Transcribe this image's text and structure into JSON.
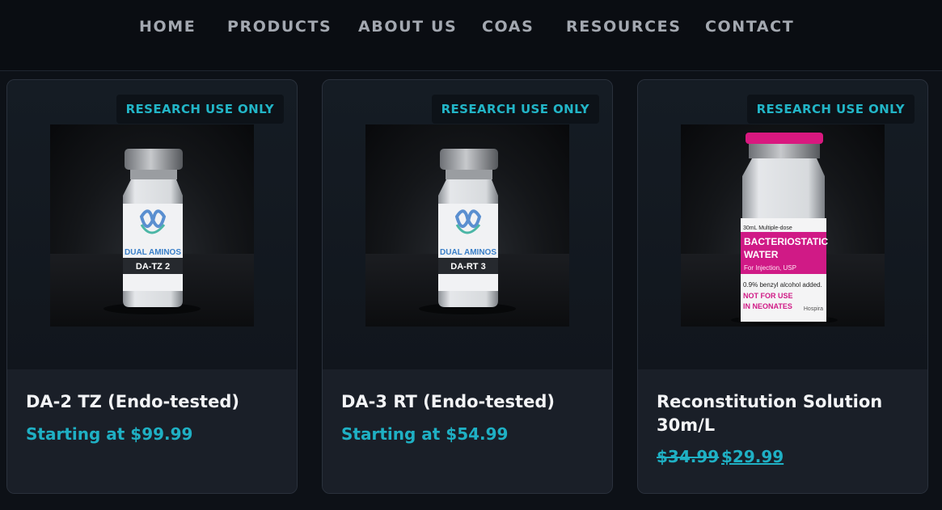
{
  "nav": {
    "items": [
      {
        "label": "HOME"
      },
      {
        "label": "PRODUCTS"
      },
      {
        "label": "ABOUT US"
      },
      {
        "label": "COAS"
      },
      {
        "label": "RESOURCES"
      },
      {
        "label": "CONTACT"
      }
    ]
  },
  "products": [
    {
      "badge": "RESEARCH USE ONLY",
      "title": "DA-2 TZ (Endo-tested)",
      "price": "Starting at $99.99",
      "vial_brand": "DUAL AMINOS",
      "vial_code": "DA-TZ 2"
    },
    {
      "badge": "RESEARCH USE ONLY",
      "title": "DA-3 RT (Endo-tested)",
      "price": "Starting at $54.99",
      "vial_brand": "DUAL AMINOS",
      "vial_code": "DA-RT 3"
    },
    {
      "badge": "RESEARCH USE ONLY",
      "title": "Reconstitution Solution 30m/L",
      "price_old": "$34.99",
      "price_new": "$29.99",
      "label_top": "30mL Multiple-dose",
      "label_name_1": "BACTERIOSTATIC",
      "label_name_2": "WATER",
      "label_use": "For Injection, USP",
      "label_note": "0.9% benzyl alcohol added.",
      "label_warn_1": "NOT FOR USE",
      "label_warn_2": "IN NEONATES",
      "label_maker": "Hospira"
    }
  ],
  "colors": {
    "accent": "#1fb0c4",
    "background": "#0d1117",
    "card": "#1a1f28",
    "magenta": "#d01a86"
  }
}
